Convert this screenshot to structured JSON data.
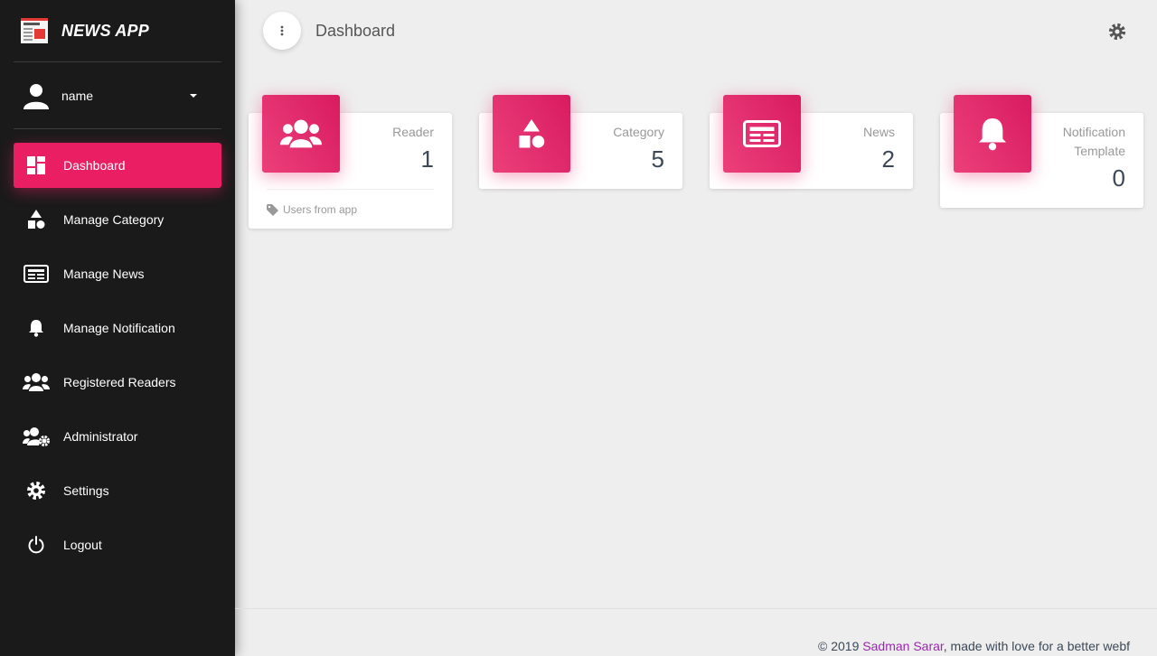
{
  "brand": {
    "title": "NEWS APP",
    "logo": "newspaper-logo"
  },
  "user": {
    "name": "name"
  },
  "sidebar": {
    "items": [
      {
        "label": "Dashboard",
        "icon": "dashboard-icon",
        "active": true
      },
      {
        "label": "Manage Category",
        "icon": "shapes-icon"
      },
      {
        "label": "Manage News",
        "icon": "newspaper-icon"
      },
      {
        "label": "Manage Notification",
        "icon": "bell-icon"
      },
      {
        "label": "Registered Readers",
        "icon": "users-icon"
      },
      {
        "label": "Administrator",
        "icon": "users-cog-icon"
      },
      {
        "label": "Settings",
        "icon": "gear-icon"
      },
      {
        "label": "Logout",
        "icon": "power-icon"
      }
    ]
  },
  "topbar": {
    "title": "Dashboard"
  },
  "cards": [
    {
      "category": "Reader",
      "value": "1",
      "icon": "users-icon",
      "footer": "Users from app"
    },
    {
      "category": "Category",
      "value": "5",
      "icon": "shapes-icon"
    },
    {
      "category": "News",
      "value": "2",
      "icon": "newspaper-icon"
    },
    {
      "category": "Notification Template",
      "value": "0",
      "icon": "bell-icon"
    }
  ],
  "footer": {
    "prefix": "© 2019 ",
    "author": "Sadman Sarar",
    "suffix": ", made with love for a better webf"
  },
  "colors": {
    "accent": "#e91e63",
    "sidebar_bg": "#1a1a1a",
    "link": "#9c27b0"
  }
}
